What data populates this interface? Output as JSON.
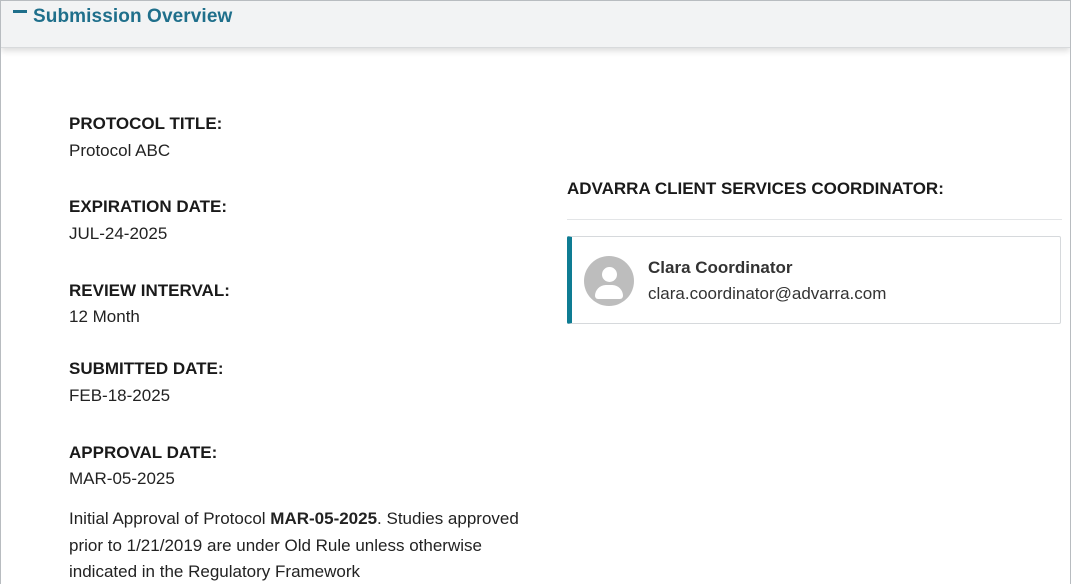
{
  "panel": {
    "title": "Submission Overview",
    "collapse_icon": "minus-icon"
  },
  "fields": [
    {
      "label": "PROTOCOL TITLE:",
      "value": "Protocol ABC"
    },
    {
      "label": "EXPIRATION DATE:",
      "value": "JUL-24-2025"
    },
    {
      "label": "REVIEW INTERVAL:",
      "value": "12 Month"
    },
    {
      "label": "SUBMITTED DATE:",
      "value": "FEB-18-2025"
    },
    {
      "label": "APPROVAL DATE:",
      "value": "MAR-05-2025"
    }
  ],
  "approval_note": {
    "prefix": "Initial Approval of Protocol ",
    "bold": "MAR-05-2025",
    "suffix": ". Studies approved prior to 1/21/2019 are under Old Rule unless otherwise indicated in the Regulatory Framework"
  },
  "coordinator": {
    "heading": "ADVARRA CLIENT SERVICES COORDINATOR:",
    "name": "Clara Coordinator",
    "email": "clara.coordinator@advarra.com",
    "avatar_icon": "user-avatar-icon"
  },
  "colors": {
    "accent": "#1f6f8b",
    "card_accent": "#0e7c93",
    "header_bg": "#f2f3f4"
  }
}
